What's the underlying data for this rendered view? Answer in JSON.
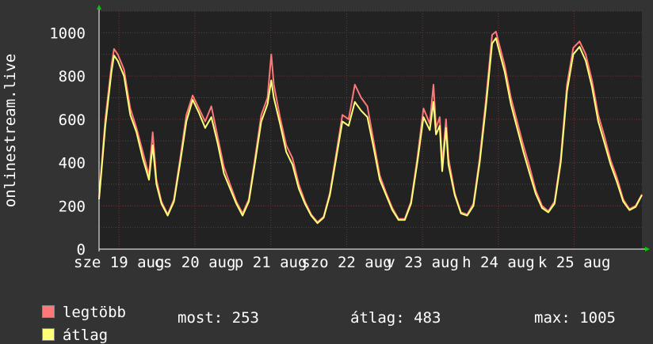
{
  "chart_data": {
    "type": "line",
    "ylabel": "onlinestream.live",
    "ylim": [
      0,
      1100
    ],
    "y_ticks": [
      "0",
      "200",
      "400",
      "600",
      "800",
      "1000"
    ],
    "x_ticks": [
      "sze 19 aug",
      "cs 20 aug",
      "p 21 aug",
      "szo 22 aug",
      "v 23 aug",
      "h 24 aug",
      "k 25 aug"
    ],
    "grid": true,
    "background": "#222222",
    "series": [
      {
        "name": "legtöbb",
        "color": "#ff7777",
        "points": [
          [
            0.0,
            240
          ],
          [
            0.05,
            600
          ],
          [
            0.1,
            850
          ],
          [
            0.12,
            925
          ],
          [
            0.15,
            900
          ],
          [
            0.2,
            830
          ],
          [
            0.25,
            650
          ],
          [
            0.3,
            560
          ],
          [
            0.35,
            450
          ],
          [
            0.4,
            340
          ],
          [
            0.43,
            540
          ],
          [
            0.46,
            320
          ],
          [
            0.5,
            220
          ],
          [
            0.55,
            160
          ],
          [
            0.6,
            230
          ],
          [
            0.65,
            420
          ],
          [
            0.7,
            620
          ],
          [
            0.75,
            710
          ],
          [
            0.8,
            650
          ],
          [
            0.85,
            590
          ],
          [
            0.9,
            660
          ],
          [
            0.95,
            520
          ],
          [
            1.0,
            380
          ],
          [
            1.05,
            300
          ],
          [
            1.1,
            220
          ],
          [
            1.15,
            165
          ],
          [
            1.2,
            230
          ],
          [
            1.25,
            420
          ],
          [
            1.3,
            620
          ],
          [
            1.35,
            700
          ],
          [
            1.38,
            900
          ],
          [
            1.4,
            760
          ],
          [
            1.45,
            610
          ],
          [
            1.5,
            480
          ],
          [
            1.55,
            420
          ],
          [
            1.6,
            300
          ],
          [
            1.65,
            220
          ],
          [
            1.7,
            160
          ],
          [
            1.75,
            125
          ],
          [
            1.8,
            150
          ],
          [
            1.85,
            260
          ],
          [
            1.9,
            440
          ],
          [
            1.95,
            620
          ],
          [
            2.0,
            600
          ],
          [
            2.05,
            760
          ],
          [
            2.1,
            700
          ],
          [
            2.15,
            660
          ],
          [
            2.2,
            500
          ],
          [
            2.25,
            340
          ],
          [
            2.3,
            260
          ],
          [
            2.35,
            190
          ],
          [
            2.4,
            140
          ],
          [
            2.45,
            140
          ],
          [
            2.5,
            220
          ],
          [
            2.55,
            420
          ],
          [
            2.6,
            650
          ],
          [
            2.65,
            580
          ],
          [
            2.68,
            760
          ],
          [
            2.7,
            560
          ],
          [
            2.73,
            610
          ],
          [
            2.75,
            390
          ],
          [
            2.78,
            600
          ],
          [
            2.8,
            420
          ],
          [
            2.85,
            260
          ],
          [
            2.9,
            170
          ],
          [
            2.95,
            160
          ],
          [
            3.0,
            210
          ],
          [
            3.05,
            420
          ],
          [
            3.1,
            690
          ],
          [
            3.15,
            990
          ],
          [
            3.18,
            1005
          ],
          [
            3.2,
            960
          ],
          [
            3.25,
            850
          ],
          [
            3.3,
            700
          ],
          [
            3.35,
            590
          ],
          [
            3.4,
            480
          ],
          [
            3.45,
            380
          ],
          [
            3.5,
            270
          ],
          [
            3.55,
            200
          ],
          [
            3.6,
            175
          ],
          [
            3.65,
            220
          ],
          [
            3.7,
            420
          ],
          [
            3.75,
            760
          ],
          [
            3.8,
            930
          ],
          [
            3.85,
            960
          ],
          [
            3.9,
            900
          ],
          [
            3.95,
            780
          ],
          [
            4.0,
            620
          ],
          [
            4.05,
            520
          ],
          [
            4.1,
            410
          ],
          [
            4.15,
            330
          ],
          [
            4.2,
            230
          ],
          [
            4.25,
            185
          ],
          [
            4.3,
            200
          ],
          [
            4.35,
            253
          ]
        ]
      },
      {
        "name": "átlag",
        "color": "#ffff77",
        "points": [
          [
            0.0,
            230
          ],
          [
            0.05,
            570
          ],
          [
            0.1,
            820
          ],
          [
            0.12,
            895
          ],
          [
            0.15,
            870
          ],
          [
            0.2,
            800
          ],
          [
            0.25,
            620
          ],
          [
            0.3,
            540
          ],
          [
            0.35,
            420
          ],
          [
            0.4,
            320
          ],
          [
            0.43,
            480
          ],
          [
            0.46,
            300
          ],
          [
            0.5,
            210
          ],
          [
            0.55,
            155
          ],
          [
            0.6,
            220
          ],
          [
            0.65,
            400
          ],
          [
            0.7,
            590
          ],
          [
            0.75,
            690
          ],
          [
            0.8,
            630
          ],
          [
            0.85,
            560
          ],
          [
            0.9,
            610
          ],
          [
            0.95,
            490
          ],
          [
            1.0,
            350
          ],
          [
            1.05,
            280
          ],
          [
            1.1,
            210
          ],
          [
            1.15,
            155
          ],
          [
            1.2,
            220
          ],
          [
            1.25,
            400
          ],
          [
            1.3,
            590
          ],
          [
            1.35,
            670
          ],
          [
            1.38,
            780
          ],
          [
            1.4,
            700
          ],
          [
            1.45,
            580
          ],
          [
            1.5,
            450
          ],
          [
            1.55,
            390
          ],
          [
            1.6,
            280
          ],
          [
            1.65,
            210
          ],
          [
            1.7,
            155
          ],
          [
            1.75,
            120
          ],
          [
            1.8,
            145
          ],
          [
            1.85,
            250
          ],
          [
            1.9,
            420
          ],
          [
            1.95,
            590
          ],
          [
            2.0,
            570
          ],
          [
            2.05,
            680
          ],
          [
            2.1,
            640
          ],
          [
            2.15,
            610
          ],
          [
            2.2,
            470
          ],
          [
            2.25,
            320
          ],
          [
            2.3,
            250
          ],
          [
            2.35,
            180
          ],
          [
            2.4,
            135
          ],
          [
            2.45,
            135
          ],
          [
            2.5,
            210
          ],
          [
            2.55,
            400
          ],
          [
            2.6,
            610
          ],
          [
            2.65,
            550
          ],
          [
            2.68,
            680
          ],
          [
            2.7,
            530
          ],
          [
            2.73,
            570
          ],
          [
            2.75,
            360
          ],
          [
            2.78,
            560
          ],
          [
            2.8,
            390
          ],
          [
            2.85,
            250
          ],
          [
            2.9,
            165
          ],
          [
            2.95,
            155
          ],
          [
            3.0,
            200
          ],
          [
            3.05,
            400
          ],
          [
            3.1,
            660
          ],
          [
            3.15,
            950
          ],
          [
            3.18,
            975
          ],
          [
            3.2,
            930
          ],
          [
            3.25,
            820
          ],
          [
            3.3,
            670
          ],
          [
            3.35,
            560
          ],
          [
            3.4,
            450
          ],
          [
            3.45,
            350
          ],
          [
            3.5,
            255
          ],
          [
            3.55,
            190
          ],
          [
            3.6,
            170
          ],
          [
            3.65,
            210
          ],
          [
            3.7,
            400
          ],
          [
            3.75,
            730
          ],
          [
            3.8,
            900
          ],
          [
            3.85,
            935
          ],
          [
            3.9,
            870
          ],
          [
            3.95,
            750
          ],
          [
            4.0,
            590
          ],
          [
            4.05,
            490
          ],
          [
            4.1,
            390
          ],
          [
            4.15,
            310
          ],
          [
            4.2,
            220
          ],
          [
            4.25,
            180
          ],
          [
            4.3,
            195
          ],
          [
            4.35,
            250
          ]
        ]
      }
    ]
  },
  "legend": [
    {
      "label": "legtöbb",
      "color": "#ff7777"
    },
    {
      "label": "átlag",
      "color": "#ffff77"
    }
  ],
  "stats": {
    "most": "most: 253",
    "atlag": "átlag: 483",
    "max": "max: 1005"
  }
}
